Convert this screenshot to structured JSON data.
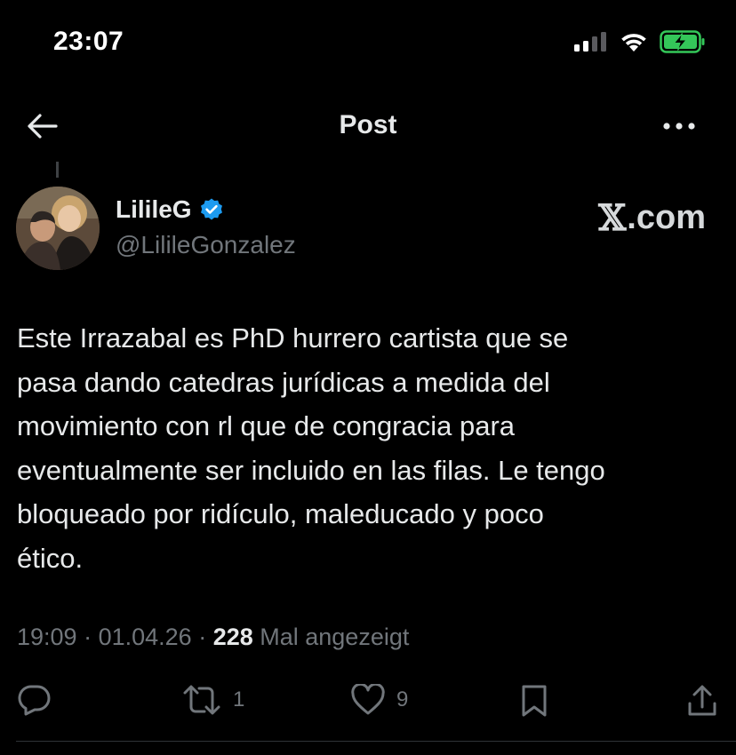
{
  "status_bar": {
    "time": "23:07",
    "icons": [
      "signal-icon",
      "wifi-icon",
      "battery-charging-icon"
    ]
  },
  "nav": {
    "title": "Post",
    "back_icon": "arrow-left-icon",
    "more_icon": "more-horizontal-icon"
  },
  "post": {
    "author_name": "LilileG",
    "author_handle": "@LilileGonzalez",
    "verified": true,
    "watermark_x": "𝕏",
    "watermark_suffix": ".com",
    "text": "Este Irrazabal es PhD hurrero cartista que se\npasa dando catedras jurídicas a medida del\nmovimiento con rl que de congracia para\neventualmente ser incluido en las filas. Le tengo\nbloqueado por ridículo, maleducado y poco\nético.",
    "time": "19:09",
    "date": "01.04.26",
    "separator": " · ",
    "views_count": "228",
    "views_label": " Mal angezeigt"
  },
  "actions": {
    "reply_count": "",
    "retweet_count": "1",
    "like_count": "9"
  },
  "colors": {
    "background": "#000000",
    "primary_text": "#e7e9ea",
    "secondary_text": "#71767b",
    "verified_blue": "#1d9bf0",
    "battery_green": "#34c759"
  }
}
